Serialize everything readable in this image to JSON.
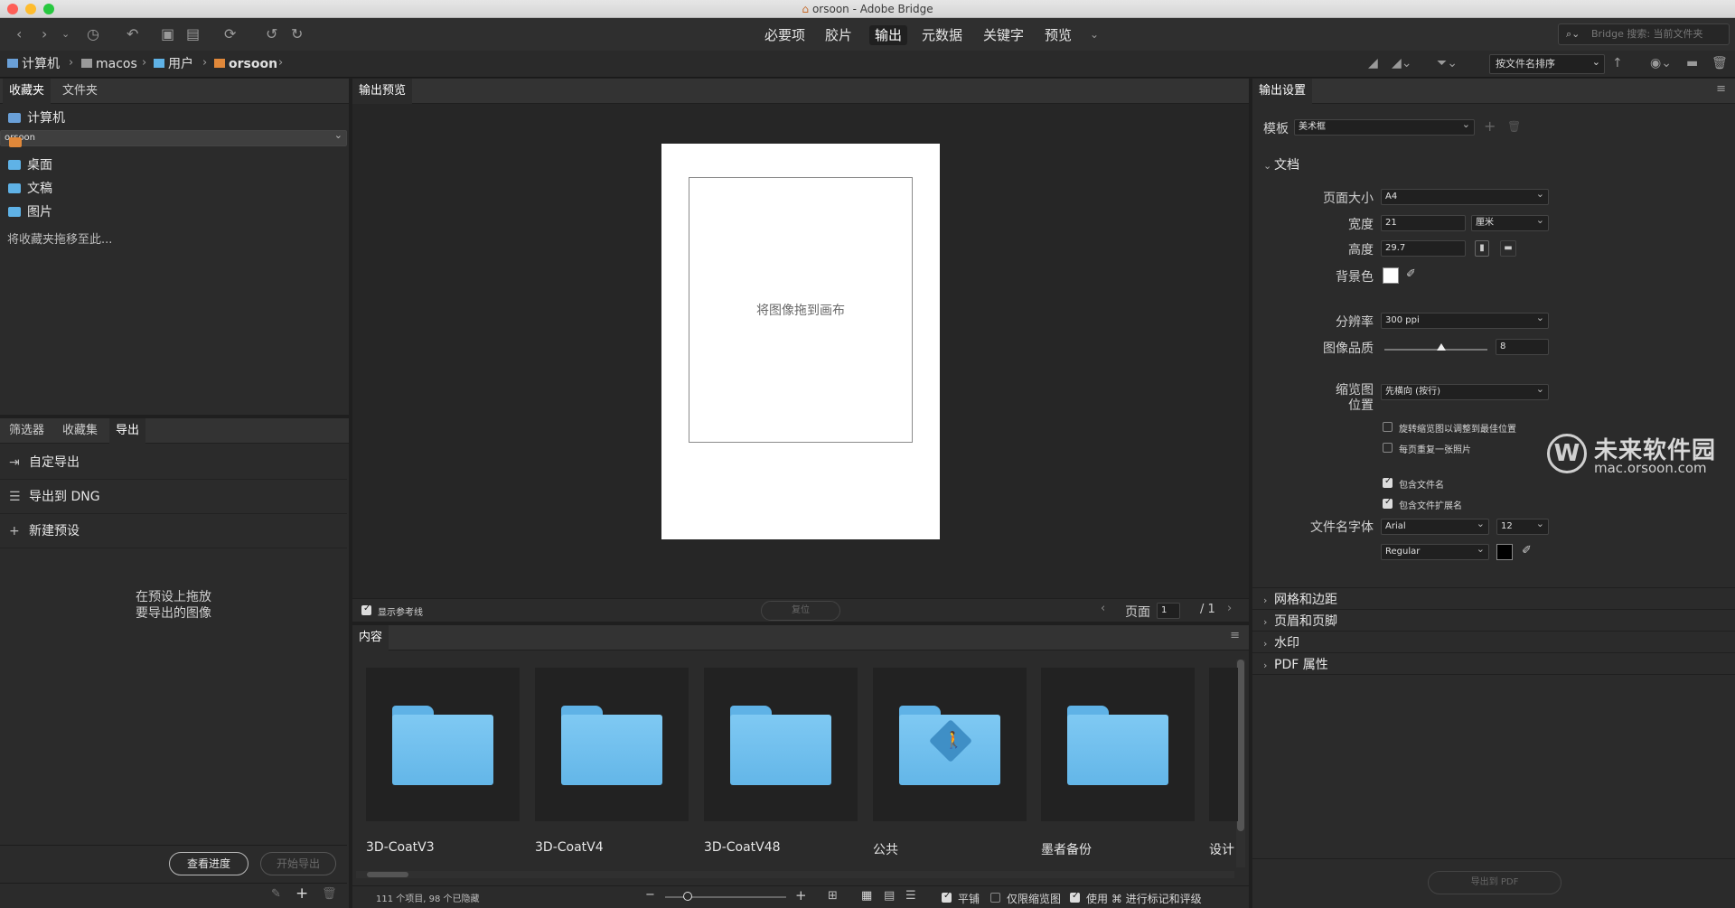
{
  "window": {
    "title": "orsoon - Adobe Bridge"
  },
  "toolbar": {
    "workspaces": [
      "必要项",
      "胶片",
      "输出",
      "元数据",
      "关键字",
      "预览"
    ],
    "active_workspace": "输出",
    "search_placeholder": "Bridge 搜索: 当前文件夹"
  },
  "pathbar": {
    "crumbs": [
      "计算机",
      "macos",
      "用户",
      "orsoon"
    ],
    "sort_label": "按文件名排序"
  },
  "left": {
    "top_tabs": [
      "收藏夹",
      "文件夹"
    ],
    "favorites": [
      "计算机",
      "orsoon",
      "桌面",
      "文稿",
      "图片"
    ],
    "favorites_hint": "将收藏夹拖移至此...",
    "bottom_tabs": [
      "筛选器",
      "收藏集",
      "导出"
    ],
    "export_items": [
      "自定导出",
      "导出到 DNG",
      "新建预设"
    ],
    "export_drop_line1": "在预设上拖放",
    "export_drop_line2": "要导出的图像",
    "view_progress": "查看进度",
    "start_export": "开始导出"
  },
  "center": {
    "preview_title": "输出预览",
    "drop_text": "将图像拖到画布",
    "show_guides": "显示参考线",
    "reset": "复位",
    "page_label": "页面",
    "page_current": "1",
    "page_total": "/ 1",
    "content_title": "内容",
    "items": [
      "3D-CoatV3",
      "3D-CoatV4",
      "3D-CoatV48",
      "公共",
      "墨者备份",
      "设计"
    ],
    "status": "111 个项目, 98 个已隐藏",
    "tile": "平铺",
    "thumbs_only": "仅限缩览图",
    "use_cmd": "使用 ⌘ 进行标记和评级"
  },
  "right": {
    "title": "输出设置",
    "template_label": "模板",
    "template_value": "美术框",
    "doc_section": "文档",
    "page_size_label": "页面大小",
    "page_size": "A4",
    "width_label": "宽度",
    "width": "21",
    "unit": "厘米",
    "height_label": "高度",
    "height": "29.7",
    "bg_label": "背景色",
    "resolution_label": "分辨率",
    "resolution": "300 ppi",
    "quality_label": "图像品质",
    "quality": "8",
    "quality_fraction": 0.55,
    "thumb_pos_label1": "缩览图",
    "thumb_pos_label2": "位置",
    "thumb_pos": "先横向 (按行)",
    "rotate_fit": "旋转缩览图以调整到最佳位置",
    "repeat_photo": "每页重复一张照片",
    "include_filename": "包含文件名",
    "include_ext": "包含文件扩展名",
    "font_label": "文件名字体",
    "font": "Arial",
    "font_size": "12",
    "font_style": "Regular",
    "sections": [
      "网格和边距",
      "页眉和页脚",
      "水印",
      "PDF 属性"
    ],
    "export_pdf": "导出到 PDF"
  },
  "watermark": {
    "brand": "未来软件园",
    "url": "mac.orsoon.com"
  }
}
